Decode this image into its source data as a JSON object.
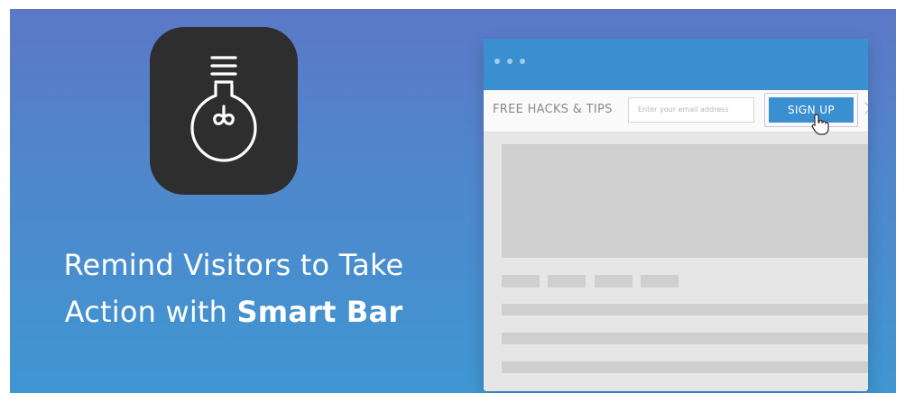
{
  "headline": {
    "line1": "Remind Visitors to Take",
    "line2_prefix": "Action with ",
    "line2_bold": "Smart Bar"
  },
  "app_icon": {
    "icon": "lightbulb-icon"
  },
  "browser": {
    "smart_bar": {
      "label": "FREE HACKS & TIPS",
      "email_placeholder": "Enter your email address",
      "button_label": "SIGN UP"
    }
  },
  "colors": {
    "background_top": "#5b78c6",
    "background_bottom": "#3f96d2",
    "app_icon_bg": "#2e2e2e",
    "browser_titlebar": "#3a8fd0",
    "button": "#3a8fd0",
    "placeholder_block": "#cfcfcf"
  }
}
